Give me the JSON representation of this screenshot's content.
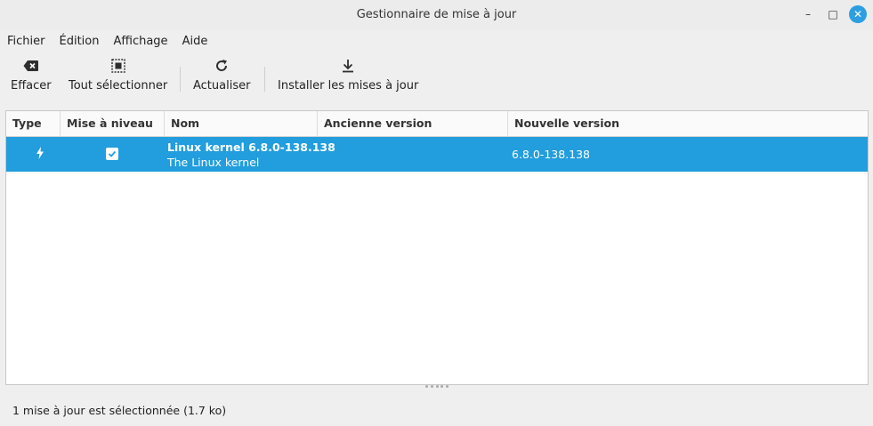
{
  "window": {
    "title": "Gestionnaire de mise à jour",
    "minimize": "–",
    "maximize": "□",
    "close": "✕"
  },
  "menu": [
    "Fichier",
    "Édition",
    "Affichage",
    "Aide"
  ],
  "toolbar": {
    "clear_label": "Effacer",
    "select_all_label": "Tout sélectionner",
    "refresh_label": "Actualiser",
    "install_label": "Installer les mises à jour"
  },
  "table": {
    "columns": [
      "Type",
      "Mise à niveau",
      "Nom",
      "Ancienne version",
      "Nouvelle version"
    ],
    "rows": [
      {
        "type_icon": "lightning-icon",
        "upgrade_checked": true,
        "name": "Linux kernel 6.8.0-138.138",
        "description": "The Linux kernel",
        "old_version": "",
        "new_version": "6.8.0-138.138"
      }
    ]
  },
  "status": "1 mise à jour est sélectionnée (1.7 ko)",
  "colors": {
    "selection": "#229ddd",
    "close_button": "#2d9fe0",
    "window_bg": "#efefef"
  }
}
